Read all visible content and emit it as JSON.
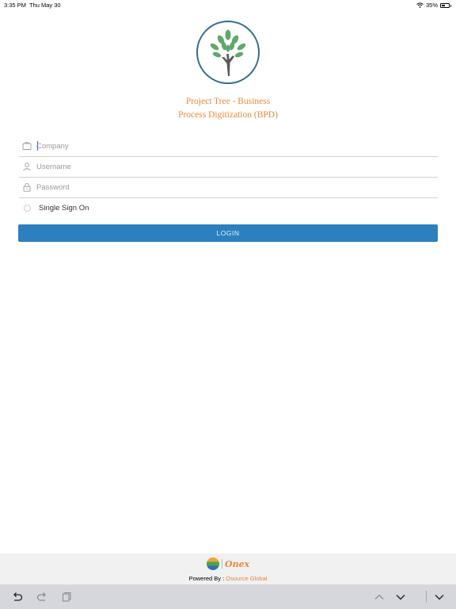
{
  "status_bar": {
    "time": "3:35 PM",
    "date": "Thu May 30",
    "battery_percent": "35%",
    "battery_level": 0.35,
    "icons": [
      "wifi-icon",
      "battery-icon"
    ]
  },
  "app": {
    "title_line1": "Project Tree - Business",
    "title_line2": "Process Digitization (BPD)",
    "logo_colors": {
      "ring": "#2d6f86",
      "leaves": "#5fa86a",
      "trunk": "#5a5a5a"
    }
  },
  "form": {
    "company": {
      "placeholder": "Company",
      "value": "",
      "icon": "briefcase-icon"
    },
    "username": {
      "placeholder": "Username",
      "value": "",
      "icon": "user-icon"
    },
    "password": {
      "placeholder": "Password",
      "value": "",
      "icon": "lock-icon"
    },
    "sso": {
      "label": "Single Sign On",
      "checked": false
    },
    "login_label": "LOGIN"
  },
  "footer": {
    "brand_text": "Onex",
    "powered_prefix": "Powered By : ",
    "powered_org": "Osource Global"
  },
  "keyboard_bar": {
    "icons": [
      "undo-icon",
      "redo-icon",
      "paste-icon",
      "previous-field-icon",
      "next-field-icon",
      "dismiss-keyboard-icon"
    ]
  },
  "colors": {
    "accent": "#e8873a",
    "button": "#2c80be",
    "field_border": "#cfcfcf"
  }
}
